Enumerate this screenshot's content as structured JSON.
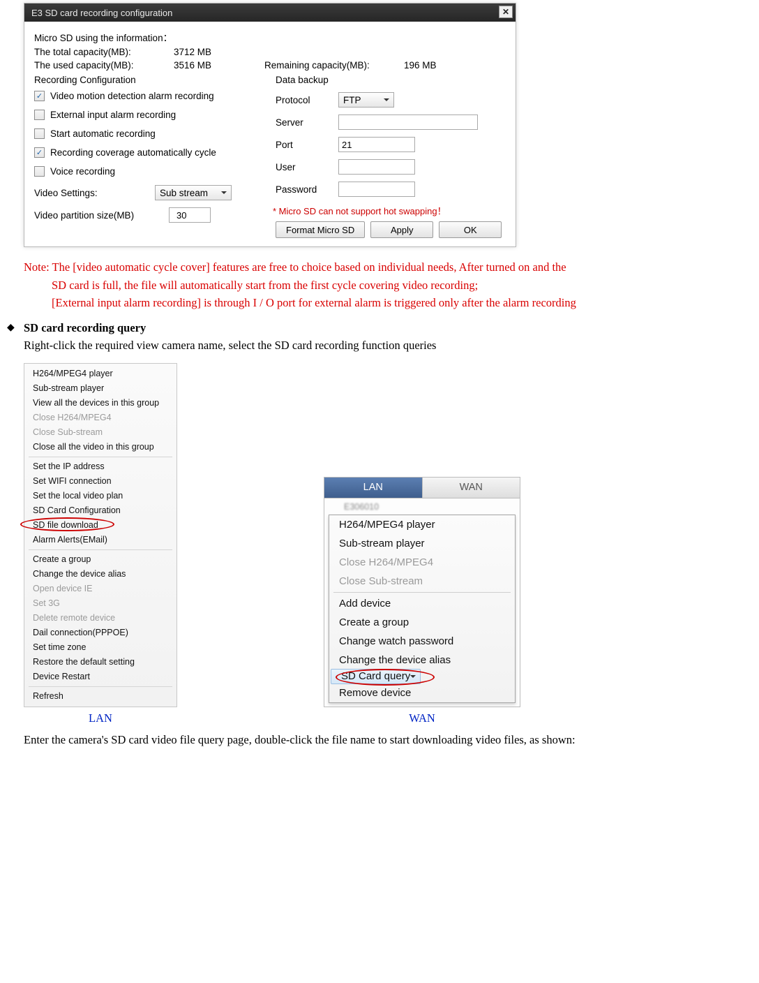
{
  "dialog": {
    "title": "E3       SD card recording configuration",
    "info_heading": "Micro SD using the information：",
    "total_label": "The total capacity(MB):",
    "total_value": "3712 MB",
    "used_label": "The used capacity(MB):",
    "used_value": "3516 MB",
    "remain_label": "Remaining capacity(MB):",
    "remain_value": "196 MB",
    "left": {
      "heading": "Recording Configuration",
      "cb1": "Video motion detection alarm recording",
      "cb2": "External input alarm recording",
      "cb3": "Start automatic recording",
      "cb4": "Recording coverage automatically cycle",
      "cb5": "Voice recording",
      "video_settings_label": "Video Settings:",
      "video_settings_value": "Sub stream",
      "partition_label": "Video partition size(MB)",
      "partition_value": "30"
    },
    "right": {
      "heading": "Data backup",
      "protocol_label": "Protocol",
      "protocol_value": "FTP",
      "server_label": "Server",
      "server_value": "",
      "port_label": "Port",
      "port_value": "21",
      "user_label": "User",
      "user_value": "",
      "password_label": "Password",
      "password_value": "",
      "warning": "* Micro SD can not support hot swapping！",
      "btn_format": "Format Micro SD",
      "btn_apply": "Apply",
      "btn_ok": "OK"
    }
  },
  "note": {
    "line1": "Note: The [video automatic cycle cover] features are free to choice based on individual needs, After turned on and the",
    "line2": "SD card is full, the file will automatically start from the first cycle covering video recording;",
    "line3": "[External input alarm recording] is through I / O port for external alarm is triggered only after the alarm recording"
  },
  "section": {
    "heading": "SD card recording query",
    "body": "Right-click the required view camera name, select the SD card recording function queries"
  },
  "lan_menu": {
    "items": [
      {
        "label": "H264/MPEG4 player",
        "disabled": false
      },
      {
        "label": "Sub-stream player",
        "disabled": false
      },
      {
        "label": "View all the devices in this group",
        "disabled": false
      },
      {
        "label": "Close H264/MPEG4",
        "disabled": true
      },
      {
        "label": "Close Sub-stream",
        "disabled": true
      },
      {
        "label": "Close all the video in this group",
        "disabled": false
      }
    ],
    "items2": [
      {
        "label": "Set the IP address",
        "disabled": false
      },
      {
        "label": "Set WIFI connection",
        "disabled": false
      },
      {
        "label": "Set the local video plan",
        "disabled": false
      },
      {
        "label": "SD Card Configuration",
        "disabled": false
      },
      {
        "label": "SD file download",
        "disabled": false,
        "highlight": true
      },
      {
        "label": "Alarm Alerts(EMail)",
        "disabled": false
      }
    ],
    "items3": [
      {
        "label": "Create a group",
        "disabled": false
      },
      {
        "label": "Change the device alias",
        "disabled": false
      },
      {
        "label": "Open device IE",
        "disabled": true
      },
      {
        "label": "Set 3G",
        "disabled": true
      },
      {
        "label": "Delete remote device",
        "disabled": true
      },
      {
        "label": "Dail connection(PPPOE)",
        "disabled": false
      },
      {
        "label": "Set time zone",
        "disabled": false
      },
      {
        "label": "Restore the default setting",
        "disabled": false
      },
      {
        "label": "Device Restart",
        "disabled": false
      }
    ],
    "items4": [
      {
        "label": "Refresh",
        "disabled": false
      }
    ]
  },
  "wan_panel": {
    "tab_lan": "LAN",
    "tab_wan": "WAN",
    "device_name": "E306010",
    "menu": [
      {
        "label": "H264/MPEG4 player",
        "disabled": false
      },
      {
        "label": "Sub-stream player",
        "disabled": false
      },
      {
        "label": "Close H264/MPEG4",
        "disabled": true
      },
      {
        "label": "Close Sub-stream",
        "disabled": true
      }
    ],
    "menu2": [
      {
        "label": "Add device",
        "disabled": false
      },
      {
        "label": "Create a group",
        "disabled": false
      },
      {
        "label": "Change watch password",
        "disabled": false
      },
      {
        "label": "Change the device alias",
        "disabled": false
      },
      {
        "label": "SD Card query",
        "disabled": false,
        "selected": true
      },
      {
        "label": "Remove device",
        "disabled": false
      }
    ]
  },
  "labels": {
    "lan": "LAN",
    "wan": "WAN"
  },
  "tail": "Enter the camera's SD card video file query page, double-click the file name to start downloading video files, as shown:"
}
